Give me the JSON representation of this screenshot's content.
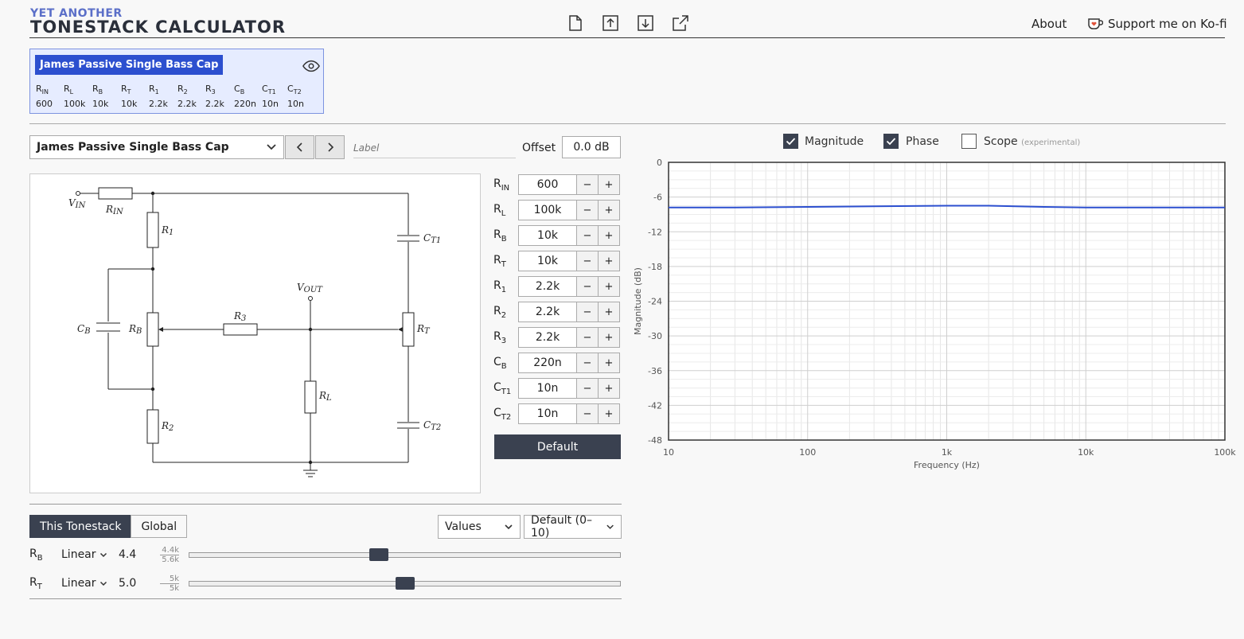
{
  "header": {
    "logo_line1": "YET ANOTHER",
    "logo_line2": "TONESTACK CALCULATOR",
    "toolbar_icons": [
      "new-file-icon",
      "upload-icon",
      "download-icon",
      "external-link-icon"
    ],
    "about": "About",
    "kofi": "Support me on Ko-fi"
  },
  "card": {
    "title": "James Passive Single Bass Cap",
    "columns": [
      {
        "name": "R",
        "sub": "IN",
        "value": "600"
      },
      {
        "name": "R",
        "sub": "L",
        "value": "100k"
      },
      {
        "name": "R",
        "sub": "B",
        "value": "10k"
      },
      {
        "name": "R",
        "sub": "T",
        "value": "10k"
      },
      {
        "name": "R",
        "sub": "1",
        "value": "2.2k"
      },
      {
        "name": "R",
        "sub": "2",
        "value": "2.2k"
      },
      {
        "name": "R",
        "sub": "3",
        "value": "2.2k"
      },
      {
        "name": "C",
        "sub": "B",
        "value": "220n"
      },
      {
        "name": "C",
        "sub": "T1",
        "value": "10n"
      },
      {
        "name": "C",
        "sub": "T2",
        "value": "10n"
      }
    ]
  },
  "selector": {
    "selected": "James Passive Single Bass Cap",
    "label_placeholder": "Label",
    "offset_label": "Offset",
    "offset_value": "0.0 dB"
  },
  "params": [
    {
      "name": "R",
      "sub": "IN",
      "value": "600"
    },
    {
      "name": "R",
      "sub": "L",
      "value": "100k"
    },
    {
      "name": "R",
      "sub": "B",
      "value": "10k"
    },
    {
      "name": "R",
      "sub": "T",
      "value": "10k"
    },
    {
      "name": "R",
      "sub": "1",
      "value": "2.2k"
    },
    {
      "name": "R",
      "sub": "2",
      "value": "2.2k"
    },
    {
      "name": "R",
      "sub": "3",
      "value": "2.2k"
    },
    {
      "name": "C",
      "sub": "B",
      "value": "220n"
    },
    {
      "name": "C",
      "sub": "T1",
      "value": "10n"
    },
    {
      "name": "C",
      "sub": "T2",
      "value": "10n"
    }
  ],
  "minus": "−",
  "plus": "+",
  "default_button": "Default",
  "tabs": [
    "This Tonestack",
    "Global"
  ],
  "dropdowns": {
    "values": "Values",
    "range": "Default (0–10)"
  },
  "sliders": [
    {
      "name": "R",
      "sub": "B",
      "taper": "Linear",
      "value": "4.4",
      "top": "4.4k",
      "bottom": "5.6k",
      "position": 0.44
    },
    {
      "name": "R",
      "sub": "T",
      "taper": "Linear",
      "value": "5.0",
      "top": "5k",
      "bottom": "5k",
      "position": 0.5
    }
  ],
  "checks": {
    "magnitude": "Magnitude",
    "phase": "Phase",
    "scope": "Scope",
    "scope_note": "(experimental)"
  },
  "schematic": {
    "vin": "V",
    "vin_sub": "IN",
    "rin": "R",
    "rin_sub": "IN",
    "r1": "R",
    "r1_sub": "1",
    "r2": "R",
    "r2_sub": "2",
    "r3": "R",
    "r3_sub": "3",
    "rb": "R",
    "rb_sub": "B",
    "rt": "R",
    "rt_sub": "T",
    "rl": "R",
    "rl_sub": "L",
    "cb": "C",
    "cb_sub": "B",
    "ct1": "C",
    "ct1_sub": "T1",
    "ct2": "C",
    "ct2_sub": "T2",
    "vout": "V",
    "vout_sub": "OUT"
  },
  "chart_data": {
    "type": "line",
    "xlabel": "Frequency (Hz)",
    "ylabel": "Magnitude (dB)",
    "x_scale": "log",
    "xlim": [
      10,
      100000
    ],
    "ylim": [
      -48,
      0
    ],
    "x_ticks": [
      "10",
      "100",
      "1k",
      "10k",
      "100k"
    ],
    "y_ticks": [
      "0",
      "-6",
      "-12",
      "-18",
      "-24",
      "-30",
      "-36",
      "-42",
      "-48"
    ],
    "grid": true,
    "series": [
      {
        "color": "#2c4fcf",
        "x": [
          10,
          30,
          100,
          300,
          1000,
          2000,
          5000,
          10000,
          30000,
          100000
        ],
        "y": [
          -7.8,
          -7.8,
          -7.7,
          -7.6,
          -7.5,
          -7.5,
          -7.7,
          -7.8,
          -7.8,
          -7.8
        ]
      }
    ]
  }
}
